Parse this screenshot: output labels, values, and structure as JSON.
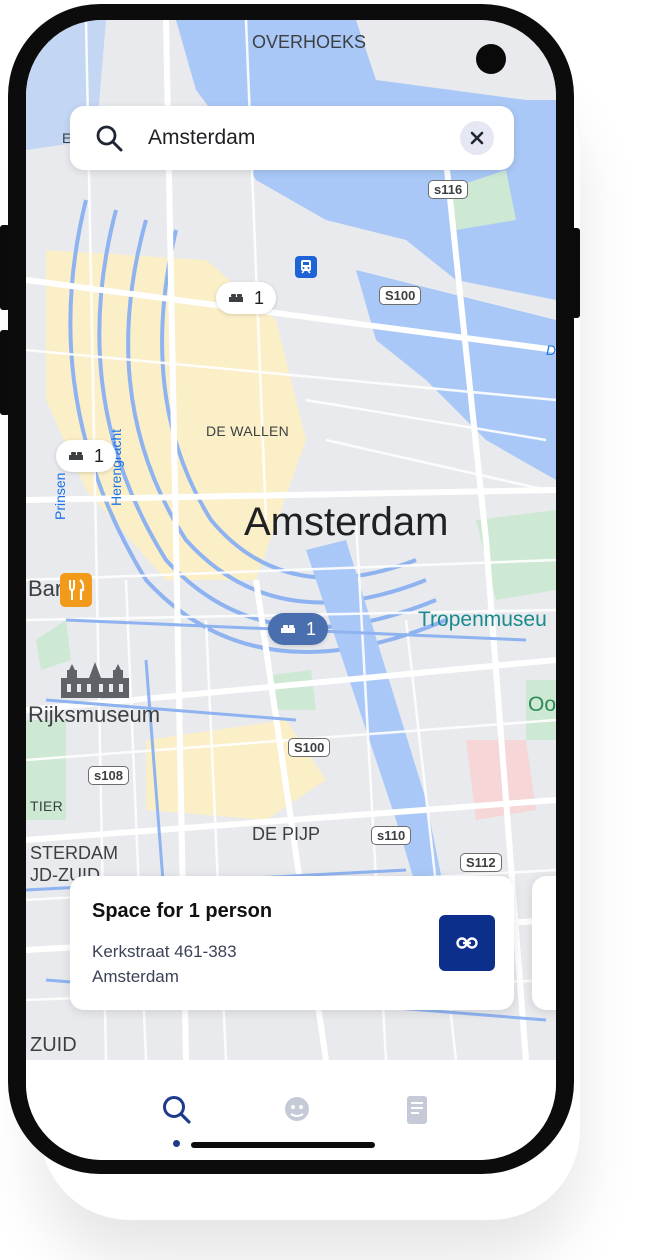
{
  "search": {
    "value": "Amsterdam",
    "icon": "search-icon",
    "clear_icon": "close-icon"
  },
  "map": {
    "labels": {
      "overhoeks": "OVERHOEKS",
      "de_wallen": "DE WALLEN",
      "city": "Amsterdam",
      "bar": "Bar",
      "rijksmuseum": "Rijksmuseum",
      "tropenmuseum": "Tropenmuseu",
      "oost": "Oos",
      "de_pijp": "DE PIJP",
      "tier": "TIER",
      "sterdam": "STERDAM",
      "zuid_zuid": "JD-ZUID",
      "zuid": "ZUID",
      "prinsengracht": "Prinsen",
      "herengracht": "Herengracht",
      "e_fragment": "E",
      "d_fragment": "D"
    },
    "routes": [
      "s116",
      "S100",
      "S100",
      "s108",
      "s110",
      "S112"
    ],
    "markers": [
      {
        "icon": "bed-icon",
        "count": "1",
        "state": "default"
      },
      {
        "icon": "bed-icon",
        "count": "1",
        "state": "default"
      },
      {
        "icon": "bed-icon",
        "count": "1",
        "state": "selected"
      }
    ]
  },
  "listing_card": {
    "title": "Space for 1 person",
    "address_line1": "Kerkstraat 461-383",
    "address_line2": "Amsterdam",
    "action_icon": "link-icon"
  },
  "bottom_nav": {
    "items": [
      {
        "icon": "search-icon",
        "active": true
      },
      {
        "icon": "chat-icon",
        "active": false
      },
      {
        "icon": "document-icon",
        "active": false
      }
    ]
  },
  "colors": {
    "water": "#aac8f7",
    "map_base": "#e8eaed",
    "marker_selected": "#4a6fae",
    "brand_button": "#0d2f8c",
    "restaurant": "#f29a1a",
    "park": "#cde9d4",
    "tourist_area": "#fbefc8"
  }
}
